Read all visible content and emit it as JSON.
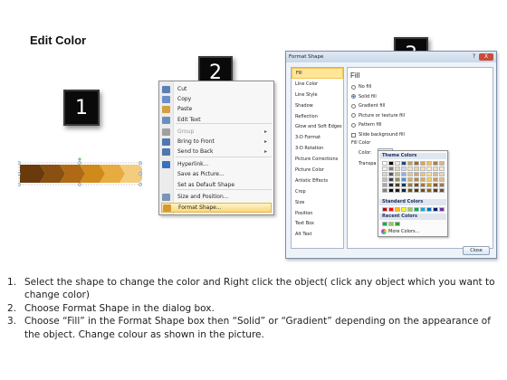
{
  "title": "Edit Color",
  "badges": [
    "1",
    "2",
    "3"
  ],
  "colors": {
    "chevrons": [
      "#6b3a0c",
      "#8a5012",
      "#b06a15",
      "#d08a1c",
      "#e7ab3f",
      "#f3cc7d"
    ],
    "highlight": "#fbd77a",
    "dialog_bg": "#eef3fa"
  },
  "context_menu": {
    "items": [
      {
        "label": "Cut",
        "icon": "scissors-icon",
        "disabled": false,
        "arrow": false,
        "highlight": false
      },
      {
        "label": "Copy",
        "icon": "copy-icon",
        "disabled": false,
        "arrow": false,
        "highlight": false
      },
      {
        "label": "Paste",
        "icon": "paste-icon",
        "disabled": false,
        "arrow": false,
        "highlight": false
      },
      {
        "label": "Edit Text",
        "icon": "edit-text-icon",
        "disabled": false,
        "arrow": false,
        "highlight": false
      },
      {
        "label": "Group",
        "icon": "group-icon",
        "disabled": true,
        "arrow": true,
        "highlight": false
      },
      {
        "label": "Bring to Front",
        "icon": "bring-front-icon",
        "disabled": false,
        "arrow": true,
        "highlight": false
      },
      {
        "label": "Send to Back",
        "icon": "send-back-icon",
        "disabled": false,
        "arrow": true,
        "highlight": false
      },
      {
        "label": "Hyperlink...",
        "icon": "hyperlink-icon",
        "disabled": false,
        "arrow": false,
        "highlight": false
      },
      {
        "label": "Save as Picture...",
        "icon": "",
        "disabled": false,
        "arrow": false,
        "highlight": false
      },
      {
        "label": "Set as Default Shape",
        "icon": "",
        "disabled": false,
        "arrow": false,
        "highlight": false
      },
      {
        "label": "Size and Position...",
        "icon": "size-position-icon",
        "disabled": false,
        "arrow": false,
        "highlight": false
      },
      {
        "label": "Format Shape...",
        "icon": "format-shape-icon",
        "disabled": false,
        "arrow": false,
        "highlight": true
      }
    ]
  },
  "dialog": {
    "title": "Format Shape",
    "help": "?",
    "close_x": "X",
    "nav": [
      "Fill",
      "Line Color",
      "Line Style",
      "Shadow",
      "Reflection",
      "Glow and Soft Edges",
      "3-D Format",
      "3-D Rotation",
      "Picture Corrections",
      "Picture Color",
      "Artistic Effects",
      "Crop",
      "Size",
      "Position",
      "Text Box",
      "Alt Text"
    ],
    "selected_nav": "Fill",
    "pane_title": "Fill",
    "fill_options": [
      "No fill",
      "Solid fill",
      "Gradient fill",
      "Picture or texture fill",
      "Pattern fill"
    ],
    "selected_fill": "Solid fill",
    "slide_background_fill": "Slide background fill",
    "fill_color_label": "Fill Color",
    "color_label": "Color:",
    "transparency_label": "Transpa",
    "close_button": "Close"
  },
  "color_popup": {
    "theme_label": "Theme Colors",
    "theme_colors": [
      [
        "#ffffff",
        "#000000",
        "#eeece1",
        "#1f497d",
        "#c8a04a",
        "#9b6b24",
        "#e0a34a",
        "#f2c14e",
        "#a67c52",
        "#d9b38c"
      ],
      [
        "#f2f2f2",
        "#7f7f7f",
        "#ddd9c3",
        "#c6d9f0",
        "#f2e4c6",
        "#e8d2ac",
        "#f7dfb8",
        "#fcefc7",
        "#ecdccb",
        "#f5e9da"
      ],
      [
        "#d8d8d8",
        "#595959",
        "#c4bd97",
        "#8db3e2",
        "#e5c98d",
        "#d2a860",
        "#efc27f",
        "#f9de8f",
        "#d9bb97",
        "#ebd3b5"
      ],
      [
        "#bfbfbf",
        "#3f3f3f",
        "#938953",
        "#548dd4",
        "#d8ae55",
        "#b8863a",
        "#e6a64a",
        "#f5cd58",
        "#c69b67",
        "#e0bd91"
      ],
      [
        "#a5a5a5",
        "#262626",
        "#494429",
        "#17365d",
        "#a37b2e",
        "#7a5118",
        "#b37425",
        "#c79a1e",
        "#7f5a34",
        "#9d7951"
      ],
      [
        "#7f7f7f",
        "#0c0c0c",
        "#1d1b10",
        "#0f243e",
        "#6d521f",
        "#513610",
        "#774d18",
        "#846614",
        "#553c23",
        "#695136"
      ]
    ],
    "standard_label": "Standard Colors",
    "standard_colors": [
      "#c00000",
      "#ff0000",
      "#ffc000",
      "#ffff00",
      "#92d050",
      "#00b050",
      "#00b0f0",
      "#0070c0",
      "#002060",
      "#7030a0"
    ],
    "recent_label": "Recent Colors",
    "recent_colors": [
      "#00b050",
      "#92d050",
      "#339933"
    ],
    "more_colors": "More Colors..."
  },
  "instructions": [
    {
      "number": "1.",
      "text": "Select the shape to change the color and Right click the object( click any object which you want to change color)"
    },
    {
      "number": "2.",
      "text": "Choose Format Shape in the dialog box."
    },
    {
      "number": "3.",
      "text": "Choose “Fill” in the Format Shape box then “Solid” or “Gradient” depending on the appearance of the object. Change colour as shown in the picture."
    }
  ]
}
